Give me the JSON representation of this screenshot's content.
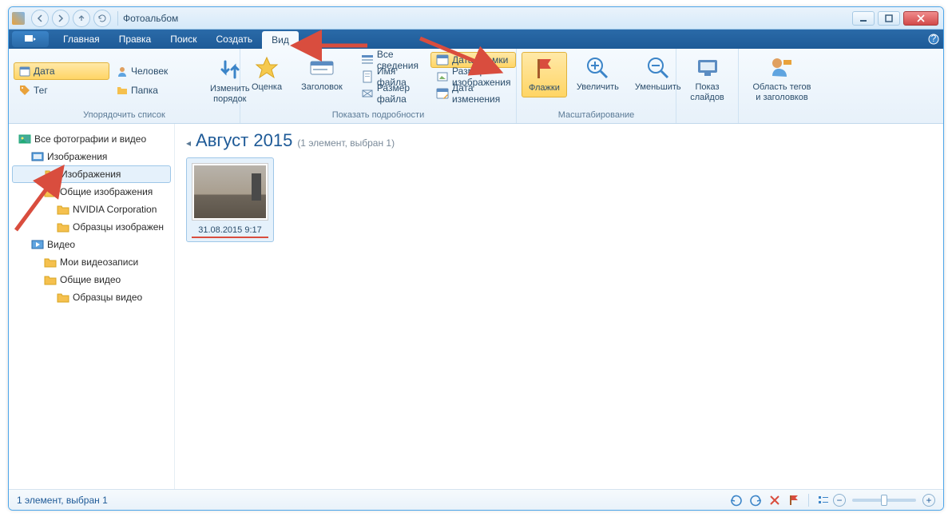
{
  "title": "Фотоальбом",
  "tabs": {
    "home": "Главная",
    "edit": "Правка",
    "find": "Поиск",
    "create": "Создать",
    "view": "Вид"
  },
  "ribbon": {
    "arrange": {
      "label": "Упорядочить список",
      "date": "Дата",
      "person": "Человек",
      "tag": "Тег",
      "folder": "Папка",
      "reorder": "Изменить\nпорядок"
    },
    "details": {
      "label": "Показать подробности",
      "rating": "Оценка",
      "title": "Заголовок",
      "allinfo": "Все сведения",
      "datetaken": "Дата съемки",
      "filename": "Имя файла",
      "imgsize": "Размер изображения",
      "filesize": "Размер файла",
      "datemod": "Дата изменения"
    },
    "scale": {
      "label": "Масштабирование",
      "flags": "Флажки",
      "zoomin": "Увеличить",
      "zoomout": "Уменьшить"
    },
    "slideshow": "Показ\nслайдов",
    "tagarea": "Область тегов\nи заголовков"
  },
  "tree": {
    "root": "Все фотографии и видео",
    "images": "Изображения",
    "images_sub": "Изображения",
    "shared_images": "Общие изображения",
    "nvidia": "NVIDIA Corporation",
    "samples_img": "Образцы изображен",
    "video": "Видео",
    "myvideo": "Мои видеозаписи",
    "shared_video": "Общие видео",
    "samples_vid": "Образцы видео"
  },
  "group": {
    "title": "Август 2015",
    "count": "(1 элемент, выбран 1)"
  },
  "thumb_caption": "31.08.2015 9:17",
  "status": "1 элемент, выбран 1"
}
